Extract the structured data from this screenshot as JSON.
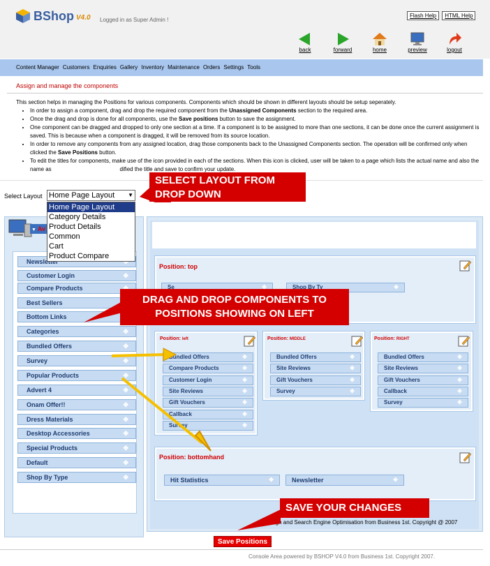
{
  "app": {
    "name": "BShop",
    "version": "V4.0",
    "logged_in": "Logged in as Super Admin !"
  },
  "help_links": [
    "Flash Help",
    "HTML Help"
  ],
  "nav_icons": [
    {
      "label": "back",
      "icon": "back-arrow-icon",
      "color": "#2aa52a"
    },
    {
      "label": "forward",
      "icon": "forward-arrow-icon",
      "color": "#2aa52a"
    },
    {
      "label": "home",
      "icon": "home-icon",
      "color": "#e07a1a"
    },
    {
      "label": "preview",
      "icon": "monitor-icon",
      "color": "#3a6fc0"
    },
    {
      "label": "logout",
      "icon": "logout-arrow-icon",
      "color": "#e03a1a"
    }
  ],
  "menu": [
    "Content Manager",
    "Customers",
    "Enquiries",
    "Gallery",
    "Inventory",
    "Maintenance",
    "Orders",
    "Settings",
    "Tools"
  ],
  "page_title": "Assign and manage the components",
  "intro": {
    "lead": "This section helps in managing the Positions for various components. Components which should be shown in different layouts should be setup seperately.",
    "b1a": "In order to assign a component, drag and drop the required component from the ",
    "b1b": "Unassigned Components",
    "b1c": " section to the required area.",
    "b2a": "Once the drag and drop is done for all components, use the ",
    "b2b": "Save positions",
    "b2c": " button to save the assignment.",
    "b3": "One component can be dragged and dropped to only one section at a time. If a component is to be assigned to more than one sections, it can be done once the current assignment is saved. This is because when a component is dragged, it will be removed from its source location.",
    "b4a": "In order to remove any components from any assigned location, drag those components back to the Unassigned Components section. The operation will be confirmed only when clicked the ",
    "b4b": "Save Positions",
    "b4c": " button.",
    "b5a": "To edit the titles for components, make use of the icon provided in each of the sections. When this icon is clicked, user will be taken to a page which lists the actual name and also the name as",
    "b5b": "dified the title and save to confirm your update."
  },
  "select_layout": {
    "label": "Select Layout",
    "value": "Home Page Layout",
    "options": [
      "Home Page Layout",
      "Category Details",
      "Product Details",
      "Common",
      "Cart",
      "Product Compare"
    ]
  },
  "callouts": {
    "select": "SELECT  LAYOUT FROM DROP DOWN",
    "drag": "DRAG AND DROP COMPONENTS TO POSITIONS SHOWING ON LEFT",
    "save": "SAVE YOUR CHANGES"
  },
  "left_header": "Av",
  "unassigned": [
    "Newsletter",
    "Customer Login",
    "Compare Products",
    "Best Sellers",
    "Bottom Links",
    "Categories",
    "Bundled Offers",
    "Survey",
    "Popular Products",
    "Advert 4",
    "Onam Offer!!",
    "Dress Materials",
    "Desktop Accessories",
    "Special Products",
    "Default",
    "Shop By Type"
  ],
  "positions": {
    "top": {
      "title": "Position: top",
      "items": [
        "Se",
        "Shop By Ty"
      ]
    },
    "left": {
      "title": "Position: ",
      "sub": "left",
      "items": [
        "Bundled Offers",
        "Compare Products",
        "Customer Login",
        "Site Reviews",
        "Gift Vouchers",
        "Callback",
        "Survey"
      ]
    },
    "middle": {
      "title": "Position: ",
      "sub": "MIDDLE",
      "items": [
        "Bundled Offers",
        "Site Reviews",
        "Gift Vouchers",
        "Survey"
      ]
    },
    "right": {
      "title": "Position: ",
      "sub": "RIGHT",
      "items": [
        "Bundled Offers",
        "Site Reviews",
        "Gift Vouchers",
        "Callback",
        "Survey"
      ]
    },
    "bottom": {
      "title": "Position: bottomhand",
      "items": [
        "Hit Statistics",
        "Newsletter"
      ]
    }
  },
  "footer_text": "e Design and Search Engine Optimisation from Business 1st. Copyright @ 2007",
  "save_button": "Save Positions",
  "powered_by": "Console Area powered by BSHOP V4.0 from Business 1st. Copyright 2007."
}
